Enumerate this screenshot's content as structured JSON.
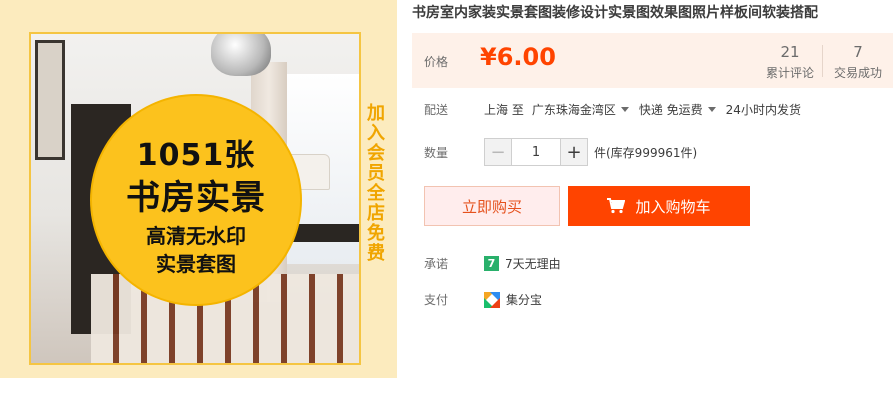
{
  "image": {
    "badge_count": "1051张",
    "badge_main": "书房实景",
    "badge_sub1": "高清无水印",
    "badge_sub2": "实景套图",
    "side_text": "加入会员 全店免费"
  },
  "product": {
    "title": "书房室内家装实景套图装修设计实景图效果图照片样板间软装搭配"
  },
  "price": {
    "label": "价格",
    "value": "¥6.00",
    "reviews_count": "21",
    "reviews_label": "累计评论",
    "deals_count": "7",
    "deals_label": "交易成功"
  },
  "delivery": {
    "label": "配送",
    "from": "上海 至",
    "to": "广东珠海金湾区",
    "method": "快递 免运费",
    "ship_time": "24小时内发货"
  },
  "quantity": {
    "label": "数量",
    "minus": "−",
    "plus": "+",
    "value": "1",
    "stock": "件(库存999961件)"
  },
  "actions": {
    "buy_now": "立即购买",
    "add_to_cart": "加入购物车"
  },
  "promise": {
    "label": "承诺",
    "icon_text": "7",
    "text": "7天无理由"
  },
  "payment": {
    "label": "支付",
    "text": "集分宝"
  },
  "colors": {
    "accent": "#ff4400",
    "badge_yellow": "#fcc21d",
    "price_bg": "#fef1e9"
  }
}
